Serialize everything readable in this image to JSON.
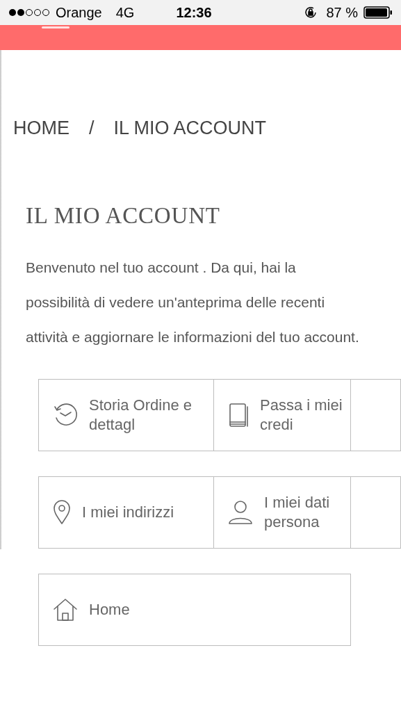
{
  "status_bar": {
    "carrier": "Orange",
    "network": "4G",
    "time": "12:36",
    "battery": "87 %"
  },
  "breadcrumb": [
    {
      "label": "HOME"
    },
    {
      "label": "/"
    },
    {
      "label": "IL MIO ACCOUNT"
    }
  ],
  "title": "IL MIO ACCOUNT",
  "intro": "Benvenuto nel tuo account . Da qui, hai la possibilità di vedere un'anteprima delle recenti attività e aggiornare le informazioni del tuo account.",
  "link_rows": [
    {
      "cards": [
        {
          "kind": "orders",
          "label": "Storia Ordine e dettagl"
        },
        {
          "kind": "credit",
          "label": "Passa i miei credi"
        },
        {
          "kind": "blank"
        }
      ]
    },
    {
      "cards": [
        {
          "kind": "addresses",
          "label": "I miei indirizzi"
        },
        {
          "kind": "personal",
          "label": "I miei dati persona"
        },
        {
          "kind": "blank"
        }
      ]
    },
    {
      "cards": [
        {
          "kind": "home",
          "label": "Home"
        }
      ]
    }
  ]
}
